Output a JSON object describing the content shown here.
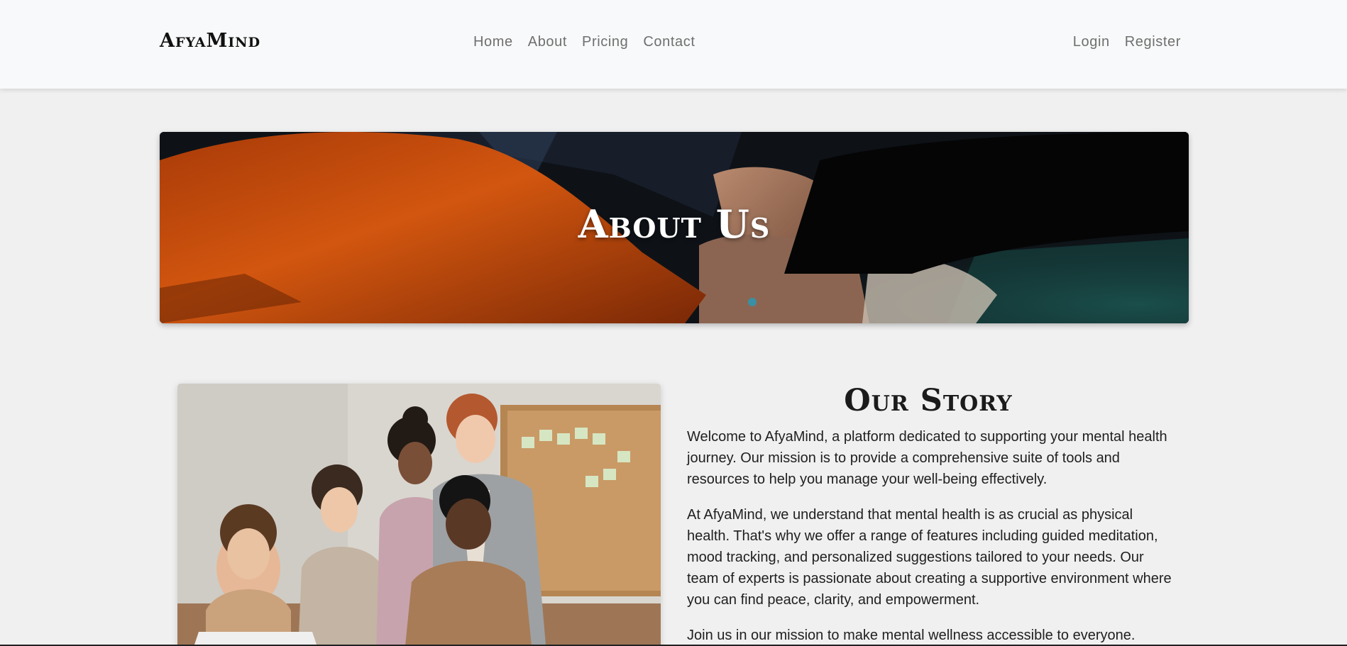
{
  "navbar": {
    "brand": "AfyaMind",
    "links": [
      {
        "label": "Home"
      },
      {
        "label": "About"
      },
      {
        "label": "Pricing"
      },
      {
        "label": "Contact"
      }
    ],
    "auth": {
      "login": "Login",
      "register": "Register"
    }
  },
  "hero": {
    "title": "About Us"
  },
  "story": {
    "title": "Our Story",
    "paragraphs": [
      "Welcome to AfyaMind, a platform dedicated to supporting your mental health journey. Our mission is to provide a comprehensive suite of tools and resources to help you manage your well-being effectively.",
      "At AfyaMind, we understand that mental health is as crucial as physical health. That's why we offer a range of features including guided meditation, mood tracking, and personalized suggestions tailored to your needs. Our team of experts is passionate about creating a supportive environment where you can find peace, clarity, and empowerment.",
      "Join us in our mission to make mental wellness accessible to everyone."
    ]
  },
  "colors": {
    "navbar_bg": "#f8f9fa",
    "page_bg": "#f0f0f0",
    "nav_link": "#6f6f6f",
    "hero_sleeve": "#c84a0c"
  }
}
